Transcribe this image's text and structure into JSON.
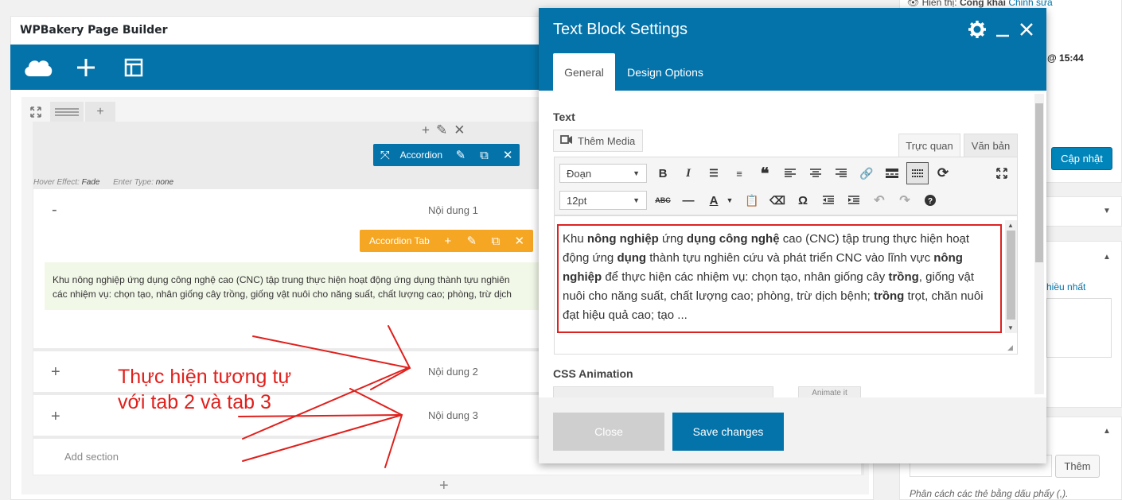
{
  "builder": {
    "title": "WPBakery Page Builder",
    "toolbar_icons": [
      "cloud-logo-icon",
      "plus-icon",
      "layout-icon"
    ]
  },
  "row_controls": [
    "expand-icon",
    "layout-lines-icon",
    "plus-icon"
  ],
  "accordion": {
    "label": "Accordion",
    "hover_label": "Hover Effect:",
    "hover_value": "Fade",
    "enter_label": "Enter Type:",
    "enter_value": "none",
    "tabs": [
      {
        "sign": "-",
        "title": "Nội dung 1"
      },
      {
        "sign": "+",
        "title": "Nội dung 2"
      },
      {
        "sign": "+",
        "title": "Nội dung 3"
      }
    ],
    "tab_badge": "Accordion Tab",
    "preview_line1": "Khu nông nghiệp ứng dụng công nghệ cao (CNC) tập trung thực hiện hoạt động ứng dụng thành tựu nghiên",
    "preview_line2": "các nhiệm vụ: chọn tạo, nhân giống cây trồng, giống vật nuôi cho năng suất, chất lượng cao; phòng, trừ dịch",
    "add_section": "Add section"
  },
  "annotation": {
    "line1": "Thực hiện tương tự",
    "line2": "với tab 2 và tab 3",
    "color": "#e0201c"
  },
  "sidebar": {
    "visibility_label": "Hiển thị:",
    "visibility_value": "Công khai",
    "edit_link": "Chỉnh sửa",
    "time": "@ 15:44",
    "update_button": "Cập nhật",
    "most_used_link": "hiều nhất",
    "tag_add": "Thêm",
    "tag_hint": "Phân cách các thẻ bằng dấu phẩy (,)."
  },
  "modal": {
    "title": "Text Block Settings",
    "tabs": [
      "General",
      "Design Options"
    ],
    "text_label": "Text",
    "add_media": "Thêm Media",
    "editor_tabs": [
      "Trực quan",
      "Văn bản"
    ],
    "format_select": "Đoạn",
    "size_select": "12pt",
    "content": {
      "p1": "Khu ",
      "b1": "nông nghiệp",
      "p2": " ứng ",
      "b2": "dụng công nghệ",
      "p3": " cao (CNC) tập trung thực hiện hoạt động ứng ",
      "b3": "dụng",
      "p4": " thành tựu nghiên cứu và phát triển CNC vào lĩnh vực ",
      "b4": "nông nghiệp",
      "p5": " để thực hiện các nhiệm vụ: chọn tạo, nhân giống cây ",
      "b5": "trồng",
      "p6": ", giống vật nuôi cho năng suất, chất lượng cao; phòng, trừ dịch bệnh; ",
      "b6": "trồng",
      "p7": " trọt, chăn nuôi đạt hiệu quả cao; tạo ..."
    },
    "css_animation_label": "CSS Animation",
    "animate_button": "Animate it",
    "close_button": "Close",
    "save_button": "Save changes",
    "accent": "#0473aa"
  }
}
